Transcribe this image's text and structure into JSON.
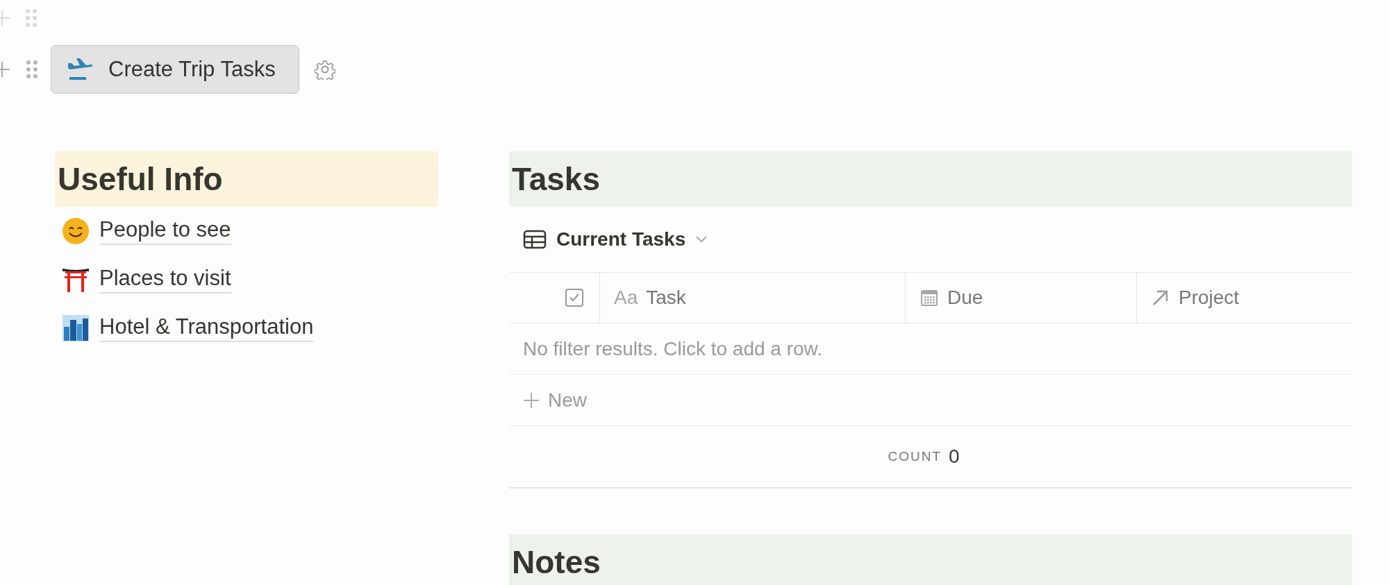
{
  "button": {
    "label": "Create Trip Tasks"
  },
  "left": {
    "heading": "Useful Info",
    "links": [
      {
        "kind": "smile",
        "label": "People to see"
      },
      {
        "kind": "gate",
        "label": "Places to visit"
      },
      {
        "kind": "city",
        "label": "Hotel & Transportation"
      }
    ]
  },
  "tasks": {
    "heading": "Tasks",
    "view": {
      "label": "Current Tasks"
    },
    "columns": [
      {
        "kind": "checkbox"
      },
      {
        "kind": "title",
        "label": "Task",
        "symbol": "Aa"
      },
      {
        "kind": "date",
        "label": "Due"
      },
      {
        "kind": "relation",
        "label": "Project"
      }
    ],
    "empty_message": "No filter results. Click to add a row.",
    "new_label": "New",
    "count_label": "COUNT",
    "count_value": "0"
  },
  "notes": {
    "heading": "Notes"
  }
}
